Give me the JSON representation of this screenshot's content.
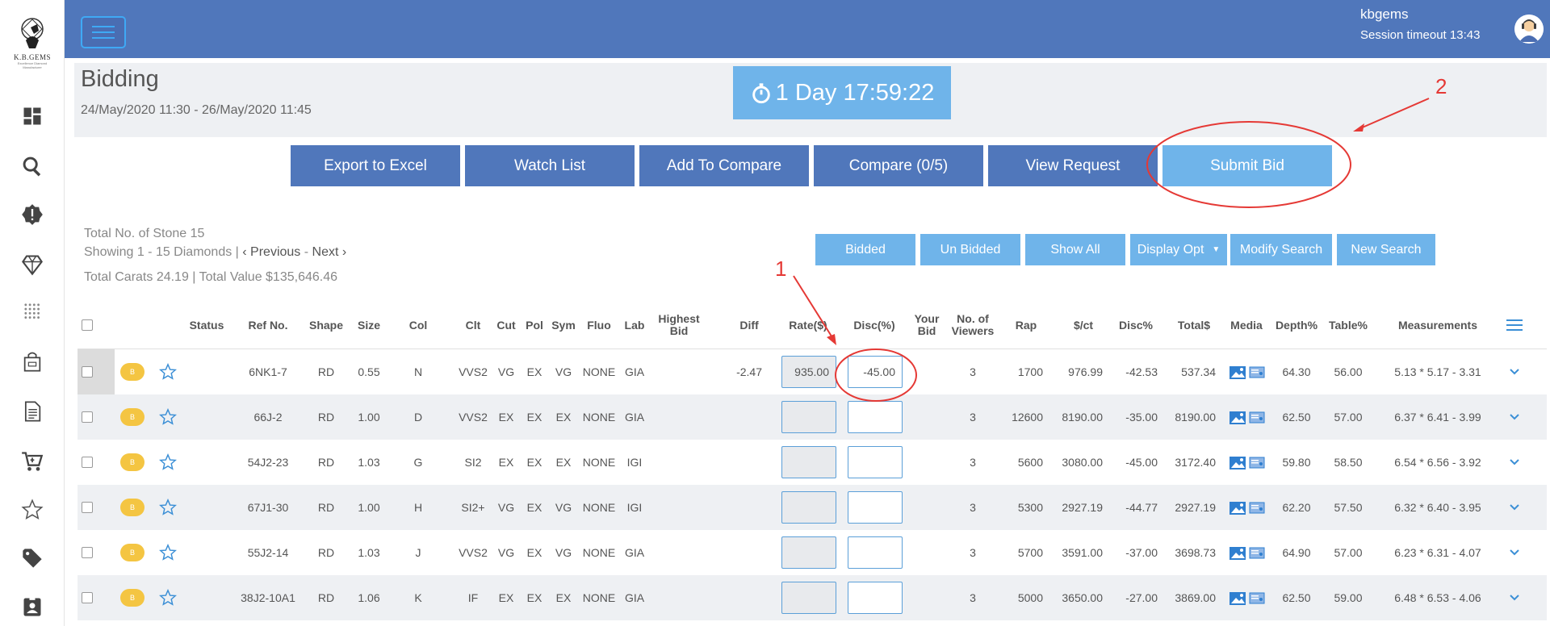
{
  "sidebar": {
    "logo_text": "K.B.GEMS",
    "logo_tagline": "Excellence Diamond Manufacturer",
    "icons": [
      "dashboard-icon",
      "search-icon",
      "alert-badge-icon",
      "diamond-icon",
      "grid-dots-icon",
      "shopping-bag-icon",
      "document-icon",
      "cart-icon",
      "star-icon",
      "tag-icon",
      "id-card-icon"
    ]
  },
  "header": {
    "user": "kbgems",
    "session": "Session timeout 13:43"
  },
  "bidding": {
    "title": "Bidding",
    "dates": "24/May/2020 11:30 - 26/May/2020 11:45",
    "timer": "1 Day 17:59:22"
  },
  "actions": {
    "export": "Export to Excel",
    "watch": "Watch List",
    "add_compare": "Add To Compare",
    "compare": "Compare (0/5)",
    "view_request": "View Request",
    "submit_bid": "Submit Bid"
  },
  "summary": {
    "total_stones": "Total No. of Stone 15",
    "showing": "Showing 1 - 15 Diamonds  |",
    "previous": "‹ Previous",
    "separator": "-",
    "next": "Next ›",
    "totals": "Total Carats 24.19 | Total Value $135,646.46"
  },
  "filters": {
    "bidded": "Bidded",
    "unbidded": "Un Bidded",
    "show_all": "Show All",
    "display_opt": "Display Opt",
    "modify_search": "Modify Search",
    "new_search": "New Search"
  },
  "table": {
    "headers": {
      "status": "Status",
      "ref": "Ref No.",
      "shape": "Shape",
      "size": "Size",
      "col": "Col",
      "clt": "Clt",
      "cut": "Cut",
      "pol": "Pol",
      "sym": "Sym",
      "fluo": "Fluo",
      "lab": "Lab",
      "highest_bid": "Highest Bid",
      "diff": "Diff",
      "rate": "Rate($)",
      "disc": "Disc(%)",
      "your_bid": "Your Bid",
      "viewers": "No. of Viewers",
      "rap": "Rap",
      "pct": "$/ct",
      "discp": "Disc%",
      "total": "Total$",
      "media": "Media",
      "depth": "Depth%",
      "tablep": "Table%",
      "measurements": "Measurements"
    },
    "rows": [
      {
        "badge": "B",
        "ref": "6NK1-7",
        "shape": "RD",
        "size": "0.55",
        "col": "N",
        "clt": "VVS2",
        "cut": "VG",
        "pol": "EX",
        "sym": "VG",
        "fluo": "NONE",
        "lab": "GIA",
        "diff": "-2.47",
        "rate": "935.00",
        "disc": "-45.00",
        "viewers": "3",
        "rap": "1700",
        "pct": "976.99",
        "discp": "-42.53",
        "total": "537.34",
        "depth": "64.30",
        "tablep": "56.00",
        "meas": "5.13 * 5.17 - 3.31"
      },
      {
        "badge": "B",
        "ref": "66J-2",
        "shape": "RD",
        "size": "1.00",
        "col": "D",
        "clt": "VVS2",
        "cut": "EX",
        "pol": "EX",
        "sym": "EX",
        "fluo": "NONE",
        "lab": "GIA",
        "diff": "",
        "rate": "",
        "disc": "",
        "viewers": "3",
        "rap": "12600",
        "pct": "8190.00",
        "discp": "-35.00",
        "total": "8190.00",
        "depth": "62.50",
        "tablep": "57.00",
        "meas": "6.37 * 6.41 - 3.99"
      },
      {
        "badge": "B",
        "ref": "54J2-23",
        "shape": "RD",
        "size": "1.03",
        "col": "G",
        "clt": "SI2",
        "cut": "EX",
        "pol": "EX",
        "sym": "EX",
        "fluo": "NONE",
        "lab": "IGI",
        "diff": "",
        "rate": "",
        "disc": "",
        "viewers": "3",
        "rap": "5600",
        "pct": "3080.00",
        "discp": "-45.00",
        "total": "3172.40",
        "depth": "59.80",
        "tablep": "58.50",
        "meas": "6.54 * 6.56 - 3.92"
      },
      {
        "badge": "B",
        "ref": "67J1-30",
        "shape": "RD",
        "size": "1.00",
        "col": "H",
        "clt": "SI2+",
        "cut": "VG",
        "pol": "EX",
        "sym": "VG",
        "fluo": "NONE",
        "lab": "IGI",
        "diff": "",
        "rate": "",
        "disc": "",
        "viewers": "3",
        "rap": "5300",
        "pct": "2927.19",
        "discp": "-44.77",
        "total": "2927.19",
        "depth": "62.20",
        "tablep": "57.50",
        "meas": "6.32 * 6.40 - 3.95"
      },
      {
        "badge": "B",
        "ref": "55J2-14",
        "shape": "RD",
        "size": "1.03",
        "col": "J",
        "clt": "VVS2",
        "cut": "VG",
        "pol": "EX",
        "sym": "VG",
        "fluo": "NONE",
        "lab": "GIA",
        "diff": "",
        "rate": "",
        "disc": "",
        "viewers": "3",
        "rap": "5700",
        "pct": "3591.00",
        "discp": "-37.00",
        "total": "3698.73",
        "depth": "64.90",
        "tablep": "57.00",
        "meas": "6.23 * 6.31 - 4.07"
      },
      {
        "badge": "B",
        "ref": "38J2-10A1",
        "shape": "RD",
        "size": "1.06",
        "col": "K",
        "clt": "IF",
        "cut": "EX",
        "pol": "EX",
        "sym": "EX",
        "fluo": "NONE",
        "lab": "GIA",
        "diff": "",
        "rate": "",
        "disc": "",
        "viewers": "3",
        "rap": "5000",
        "pct": "3650.00",
        "discp": "-27.00",
        "total": "3869.00",
        "depth": "62.50",
        "tablep": "59.00",
        "meas": "6.48 * 6.53 - 4.06"
      }
    ]
  },
  "annotations": {
    "one": "1",
    "two": "2"
  },
  "colors": {
    "primary": "#5077bb",
    "light": "#6fb4ea",
    "badge": "#f4c542",
    "annotation": "#e53935"
  }
}
